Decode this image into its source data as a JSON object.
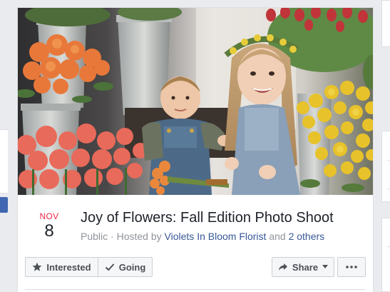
{
  "event": {
    "date": {
      "month": "NOV",
      "day": "8"
    },
    "title": "Joy of Flowers: Fall Edition Photo Shoot",
    "meta": {
      "privacy": "Public",
      "separator": " · ",
      "hosted_by_prefix": "Hosted by ",
      "host": "Violets In Bloom Florist",
      "and_text": " and ",
      "others": "2 others"
    }
  },
  "actions": {
    "interested_label": "Interested",
    "going_label": "Going",
    "share_label": "Share"
  },
  "icons": {
    "interested": "star-icon",
    "going": "check-icon",
    "share": "share-arrow-icon",
    "share_dropdown": "caret-down-icon",
    "more": "more-dots-icon"
  },
  "colors": {
    "month": "#f02849",
    "link": "#385898",
    "muted": "#90949c",
    "button_bg": "#f5f6f7",
    "page_bg": "#e9ebee",
    "accent_blue": "#4267b2"
  }
}
